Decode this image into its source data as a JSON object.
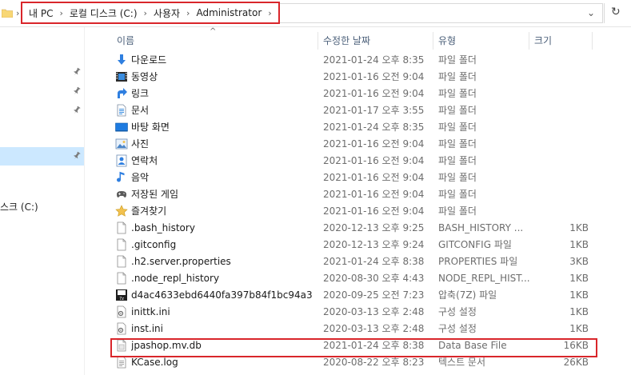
{
  "address": {
    "crumbs": [
      "내 PC",
      "로컬 디스크 (C:)",
      "사용자",
      "Administrator"
    ],
    "dropdown_icon": "chevron-down-icon",
    "refresh_icon": "refresh-icon"
  },
  "nav": {
    "drive_label": "스크 (C:)"
  },
  "columns": {
    "name": "이름",
    "date": "수정한 날짜",
    "type": "유형",
    "size": "크기"
  },
  "files": [
    {
      "name": "다운로드",
      "date": "2021-01-24 오후 8:35",
      "type": "파일 폴더",
      "size": "",
      "icon": "download"
    },
    {
      "name": "동영상",
      "date": "2021-01-16 오전 9:04",
      "type": "파일 폴더",
      "size": "",
      "icon": "video"
    },
    {
      "name": "링크",
      "date": "2021-01-16 오전 9:04",
      "type": "파일 폴더",
      "size": "",
      "icon": "link"
    },
    {
      "name": "문서",
      "date": "2021-01-17 오후 3:55",
      "type": "파일 폴더",
      "size": "",
      "icon": "document"
    },
    {
      "name": "바탕 화면",
      "date": "2021-01-24 오후 8:35",
      "type": "파일 폴더",
      "size": "",
      "icon": "desktop"
    },
    {
      "name": "사진",
      "date": "2021-01-16 오전 9:04",
      "type": "파일 폴더",
      "size": "",
      "icon": "picture"
    },
    {
      "name": "연락처",
      "date": "2021-01-16 오전 9:04",
      "type": "파일 폴더",
      "size": "",
      "icon": "contacts"
    },
    {
      "name": "음악",
      "date": "2021-01-16 오전 9:04",
      "type": "파일 폴더",
      "size": "",
      "icon": "music"
    },
    {
      "name": "저장된 게임",
      "date": "2021-01-16 오전 9:04",
      "type": "파일 폴더",
      "size": "",
      "icon": "games"
    },
    {
      "name": "즐겨찾기",
      "date": "2021-01-16 오전 9:04",
      "type": "파일 폴더",
      "size": "",
      "icon": "star"
    },
    {
      "name": ".bash_history",
      "date": "2020-12-13 오후 9:25",
      "type": "BASH_HISTORY ...",
      "size": "1KB",
      "icon": "file"
    },
    {
      "name": ".gitconfig",
      "date": "2020-12-13 오후 9:24",
      "type": "GITCONFIG 파일",
      "size": "1KB",
      "icon": "file"
    },
    {
      "name": ".h2.server.properties",
      "date": "2021-01-24 오후 8:38",
      "type": "PROPERTIES 파일",
      "size": "3KB",
      "icon": "file"
    },
    {
      "name": ".node_repl_history",
      "date": "2020-08-30 오후 4:43",
      "type": "NODE_REPL_HIST...",
      "size": "1KB",
      "icon": "file"
    },
    {
      "name": "d4ac4633ebd6440fa397b84f1bc94a3c....",
      "date": "2020-09-25 오전 7:23",
      "type": "압축(7Z) 파일",
      "size": "1KB",
      "icon": "archive"
    },
    {
      "name": "inittk.ini",
      "date": "2020-03-13 오후 2:48",
      "type": "구성 설정",
      "size": "1KB",
      "icon": "settings-file"
    },
    {
      "name": "inst.ini",
      "date": "2020-03-13 오후 2:48",
      "type": "구성 설정",
      "size": "1KB",
      "icon": "settings-file"
    },
    {
      "name": "jpashop.mv.db",
      "date": "2021-01-24 오후 8:38",
      "type": "Data Base File",
      "size": "16KB",
      "icon": "db-file"
    },
    {
      "name": "KCase.log",
      "date": "2020-08-22 오후 8:23",
      "type": "텍스트 문서",
      "size": "26KB",
      "icon": "text-file"
    }
  ],
  "colors": {
    "highlight": "#d9262b",
    "selection": "#cce8ff",
    "folder": "#f8d775"
  }
}
